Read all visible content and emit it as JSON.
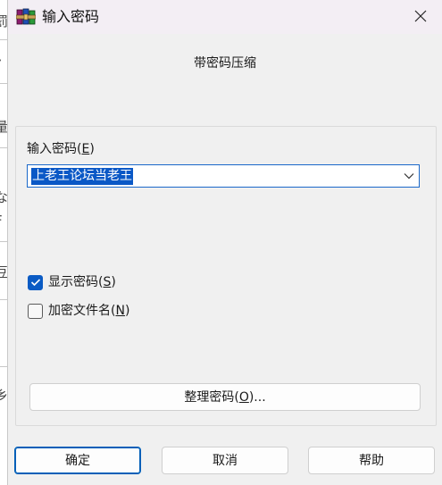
{
  "window": {
    "title": "输入密码",
    "app_icon": "winrar-books-icon",
    "close_icon": "close-icon"
  },
  "subtitle": "带密码压缩",
  "password": {
    "label_text": "输入密码(",
    "label_key": "E",
    "label_end": ")",
    "value": "上老王论坛当老王",
    "dropdown_icon": "chevron-down-icon"
  },
  "options": {
    "show_password": {
      "label_text": "显示密码(",
      "label_key": "S",
      "label_end": ")",
      "checked": true
    },
    "encrypt_filenames": {
      "label_text": "加密文件名(",
      "label_key": "N",
      "label_end": ")",
      "checked": false
    }
  },
  "organize_button": {
    "label_text": "整理密码(",
    "label_key": "O",
    "label_end": ")..."
  },
  "buttons": {
    "ok": "确定",
    "cancel": "取消",
    "help": "帮助"
  },
  "background_window": {
    "fragments": [
      "罰",
      "亻",
      "量",
      "な",
      "F",
      "豆",
      "/",
      "乡"
    ]
  },
  "colors": {
    "accent": "#0a5bc4",
    "selection": "#0a58c6",
    "titlebar": "#f3eef4",
    "dialog_bg": "#f0f0f0"
  }
}
